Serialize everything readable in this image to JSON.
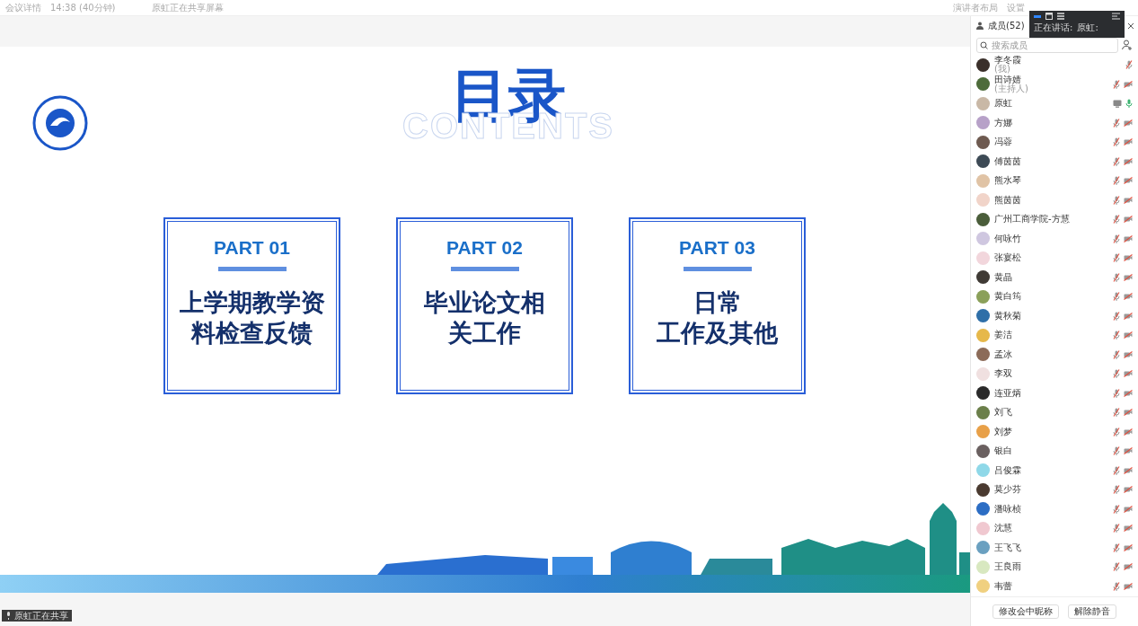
{
  "top_bar": {
    "meeting_info": "会议详情",
    "duration": "14:38 (40分钟)",
    "sharing_notice": "原虹正在共享屏幕",
    "layout_button": "演讲者布局",
    "settings_button": "设置"
  },
  "slide": {
    "title": "目录",
    "subtitle": "CONTENTS",
    "cards": [
      {
        "part": "PART 01",
        "lines": [
          "上学期教学资",
          "料检查反馈"
        ]
      },
      {
        "part": "PART 02",
        "lines": [
          "毕业论文相",
          "关工作"
        ]
      },
      {
        "part": "PART 03",
        "lines": [
          "日常",
          "工作及其他"
        ]
      }
    ]
  },
  "share_badge": "原虹正在共享",
  "speaking_popup": {
    "label": "正在讲话:",
    "speaker": "原虹:"
  },
  "members_panel": {
    "title": "成员(52)",
    "search": {
      "placeholder": "搜索成员"
    },
    "members": [
      {
        "name": "李冬霞",
        "role": "(我)",
        "mic_muted": true,
        "camera_off": false,
        "sharing": false
      },
      {
        "name": "田诗婧",
        "role": "(主持人)",
        "mic_muted": true,
        "camera_off": true,
        "sharing": false
      },
      {
        "name": "原虹",
        "mic_muted": false,
        "camera_off": false,
        "sharing": true
      },
      {
        "name": "方娜",
        "mic_muted": true,
        "camera_off": true,
        "sharing": false
      },
      {
        "name": "冯蓉",
        "mic_muted": true,
        "camera_off": true,
        "sharing": false
      },
      {
        "name": "傅茵茵",
        "mic_muted": true,
        "camera_off": true,
        "sharing": false
      },
      {
        "name": "熊水琴",
        "mic_muted": true,
        "camera_off": true,
        "sharing": false
      },
      {
        "name": "熊茵茵",
        "mic_muted": true,
        "camera_off": true,
        "sharing": false
      },
      {
        "name": "广州工商学院-方慧",
        "mic_muted": true,
        "camera_off": true,
        "sharing": false
      },
      {
        "name": "何咏竹",
        "mic_muted": true,
        "camera_off": true,
        "sharing": false
      },
      {
        "name": "张宴松",
        "mic_muted": true,
        "camera_off": true,
        "sharing": false
      },
      {
        "name": "黄晶",
        "mic_muted": true,
        "camera_off": true,
        "sharing": false
      },
      {
        "name": "黄白筠",
        "mic_muted": true,
        "camera_off": true,
        "sharing": false
      },
      {
        "name": "黄秋菊",
        "mic_muted": true,
        "camera_off": true,
        "sharing": false
      },
      {
        "name": "姜洁",
        "mic_muted": true,
        "camera_off": true,
        "sharing": false
      },
      {
        "name": "孟冰",
        "mic_muted": true,
        "camera_off": true,
        "sharing": false
      },
      {
        "name": "李双",
        "mic_muted": true,
        "camera_off": true,
        "sharing": false
      },
      {
        "name": "连亚炳",
        "mic_muted": true,
        "camera_off": true,
        "sharing": false
      },
      {
        "name": "刘飞",
        "mic_muted": true,
        "camera_off": true,
        "sharing": false
      },
      {
        "name": "刘梦",
        "mic_muted": true,
        "camera_off": true,
        "sharing": false
      },
      {
        "name": "银白",
        "mic_muted": true,
        "camera_off": true,
        "sharing": false
      },
      {
        "name": "吕俊霖",
        "mic_muted": true,
        "camera_off": true,
        "sharing": false
      },
      {
        "name": "莫少芬",
        "mic_muted": true,
        "camera_off": true,
        "sharing": false
      },
      {
        "name": "潘咏桢",
        "mic_muted": true,
        "camera_off": true,
        "sharing": false
      },
      {
        "name": "沈慧",
        "mic_muted": true,
        "camera_off": true,
        "sharing": false
      },
      {
        "name": "王飞飞",
        "mic_muted": true,
        "camera_off": true,
        "sharing": false
      },
      {
        "name": "王良雨",
        "mic_muted": true,
        "camera_off": true,
        "sharing": false
      },
      {
        "name": "韦蕾",
        "mic_muted": true,
        "camera_off": true,
        "sharing": false
      }
    ],
    "buttons": [
      "修改会中昵称",
      "解除静音"
    ]
  }
}
